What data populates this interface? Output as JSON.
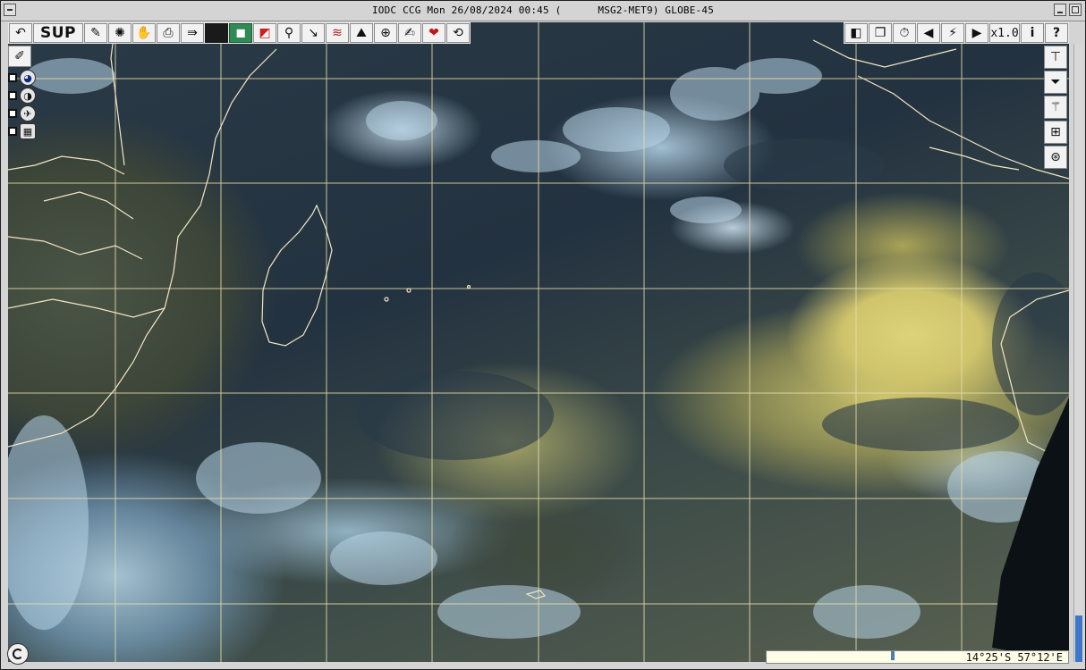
{
  "window": {
    "title": "IODC CCG Mon 26/08/2024 00:45 (      MSG2-MET9) GLOBE-45"
  },
  "toolbar": {
    "sup_label": "SUP",
    "zoom_label": "x1.0",
    "help_label": "?",
    "info_label": "i",
    "prev_label": "◀",
    "next_label": "▶"
  },
  "status": {
    "coordinates": "14°25'S 57°12'E"
  },
  "colors": {
    "gridline": "#e9dfaa",
    "coastline": "#f2e6c4",
    "active_button": "#2f8a55",
    "scroll_thumb": "#3d76c9"
  }
}
